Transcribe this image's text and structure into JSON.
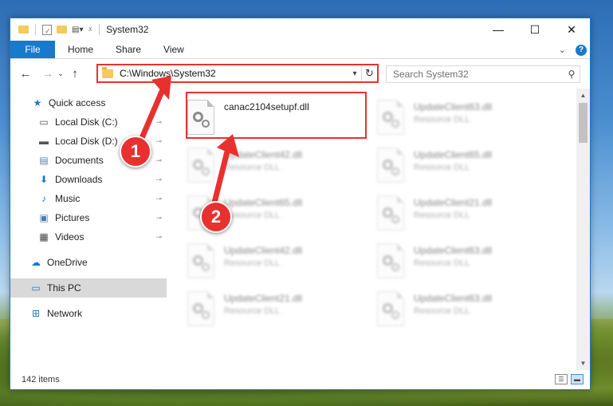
{
  "window": {
    "title": "System32",
    "controls": {
      "minimize": "—",
      "maximize": "☐",
      "close": "✕"
    }
  },
  "ribbon": {
    "tabs": [
      "File",
      "Home",
      "Share",
      "View"
    ],
    "expand_icon": "chevron-down-icon",
    "help_label": "?"
  },
  "nav": {
    "back": "←",
    "forward": "→",
    "up": "↑",
    "address": "C:\\Windows\\System32",
    "dropdown": "▾",
    "refresh": "↻",
    "search_placeholder": "Search System32",
    "search_icon": "⚲"
  },
  "sidebar": {
    "items": [
      {
        "label": "Quick access",
        "icon": "star-icon",
        "glyph": "★",
        "color": "#1979ca",
        "pinned": false
      },
      {
        "label": "Local Disk (C:)",
        "icon": "drive-icon",
        "glyph": "▭",
        "color": "#555555",
        "pinned": true
      },
      {
        "label": "Local Disk (D:)",
        "icon": "drive-icon",
        "glyph": "▬",
        "color": "#555555",
        "pinned": true
      },
      {
        "label": "Documents",
        "icon": "documents-icon",
        "glyph": "▤",
        "color": "#5a7fa8",
        "pinned": true
      },
      {
        "label": "Downloads",
        "icon": "downloads-icon",
        "glyph": "⬇",
        "color": "#1979ca",
        "pinned": true
      },
      {
        "label": "Music",
        "icon": "music-icon",
        "glyph": "♪",
        "color": "#1979ca",
        "pinned": true
      },
      {
        "label": "Pictures",
        "icon": "pictures-icon",
        "glyph": "▣",
        "color": "#4a7ab0",
        "pinned": true
      },
      {
        "label": "Videos",
        "icon": "videos-icon",
        "glyph": "▦",
        "color": "#444444",
        "pinned": true
      },
      {
        "label": "OneDrive",
        "icon": "onedrive-icon",
        "glyph": "☁",
        "color": "#1979ca",
        "pinned": false
      },
      {
        "label": "This PC",
        "icon": "this-pc-icon",
        "glyph": "▭",
        "color": "#1979ca",
        "pinned": false,
        "selected": true
      },
      {
        "label": "Network",
        "icon": "network-icon",
        "glyph": "⊞",
        "color": "#1979ca",
        "pinned": false
      }
    ],
    "pin_glyph": "📌"
  },
  "files": {
    "highlighted": {
      "name": "canac2104setupf.dll",
      "type": ""
    },
    "blurred": [
      {
        "name": "UpdateClient63.dll",
        "type": "Resource DLL"
      },
      {
        "name": "UpdateClient42.dll",
        "type": "Resource DLL"
      },
      {
        "name": "UpdateClient65.dll",
        "type": "Resource DLL"
      },
      {
        "name": "UpdateClient65.dll",
        "type": "Resource DLL"
      },
      {
        "name": "UpdateClient21.dll",
        "type": "Resource DLL"
      },
      {
        "name": "UpdateClient63.dll",
        "type": "Resource DLL"
      },
      {
        "name": "UpdateClient42.dll",
        "type": "Resource DLL"
      },
      {
        "name": "UpdateClient21.dll",
        "type": "Resource DLL"
      },
      {
        "name": "UpdateClient63.dll",
        "type": "Resource DLL"
      }
    ]
  },
  "status": {
    "count": "142 items"
  },
  "callouts": {
    "one": "1",
    "two": "2"
  },
  "colors": {
    "accent": "#1979ca",
    "highlight": "#e8312f"
  }
}
